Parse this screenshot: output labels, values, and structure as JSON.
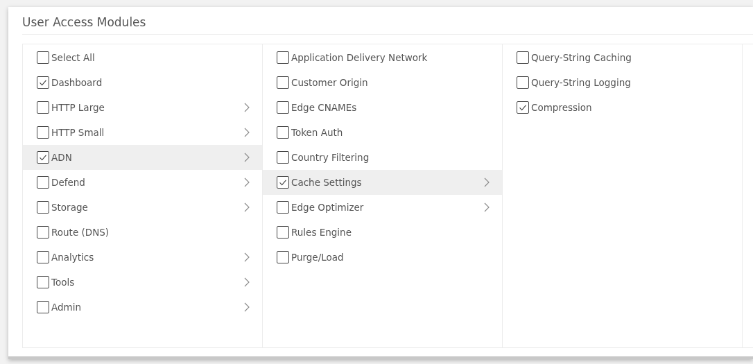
{
  "panel": {
    "title": "User Access Modules"
  },
  "columns": [
    {
      "items": [
        {
          "label": "Select All",
          "checked": false,
          "has_submenu": false,
          "selected": false
        },
        {
          "label": "Dashboard",
          "checked": true,
          "has_submenu": false,
          "selected": false
        },
        {
          "label": "HTTP Large",
          "checked": false,
          "has_submenu": true,
          "selected": false
        },
        {
          "label": "HTTP Small",
          "checked": false,
          "has_submenu": true,
          "selected": false
        },
        {
          "label": "ADN",
          "checked": true,
          "has_submenu": true,
          "selected": true
        },
        {
          "label": "Defend",
          "checked": false,
          "has_submenu": true,
          "selected": false
        },
        {
          "label": "Storage",
          "checked": false,
          "has_submenu": true,
          "selected": false
        },
        {
          "label": "Route (DNS)",
          "checked": false,
          "has_submenu": false,
          "selected": false
        },
        {
          "label": "Analytics",
          "checked": false,
          "has_submenu": true,
          "selected": false
        },
        {
          "label": "Tools",
          "checked": false,
          "has_submenu": true,
          "selected": false
        },
        {
          "label": "Admin",
          "checked": false,
          "has_submenu": true,
          "selected": false
        }
      ]
    },
    {
      "items": [
        {
          "label": "Application Delivery Network",
          "checked": false,
          "has_submenu": false,
          "selected": false
        },
        {
          "label": "Customer Origin",
          "checked": false,
          "has_submenu": false,
          "selected": false
        },
        {
          "label": "Edge CNAMEs",
          "checked": false,
          "has_submenu": false,
          "selected": false
        },
        {
          "label": "Token Auth",
          "checked": false,
          "has_submenu": false,
          "selected": false
        },
        {
          "label": "Country Filtering",
          "checked": false,
          "has_submenu": false,
          "selected": false
        },
        {
          "label": "Cache Settings",
          "checked": true,
          "has_submenu": true,
          "selected": true
        },
        {
          "label": "Edge Optimizer",
          "checked": false,
          "has_submenu": true,
          "selected": false
        },
        {
          "label": "Rules Engine",
          "checked": false,
          "has_submenu": false,
          "selected": false
        },
        {
          "label": "Purge/Load",
          "checked": false,
          "has_submenu": false,
          "selected": false
        }
      ]
    },
    {
      "items": [
        {
          "label": "Query-String Caching",
          "checked": false,
          "has_submenu": false,
          "selected": false
        },
        {
          "label": "Query-String Logging",
          "checked": false,
          "has_submenu": false,
          "selected": false
        },
        {
          "label": "Compression",
          "checked": true,
          "has_submenu": false,
          "selected": false
        }
      ]
    }
  ]
}
